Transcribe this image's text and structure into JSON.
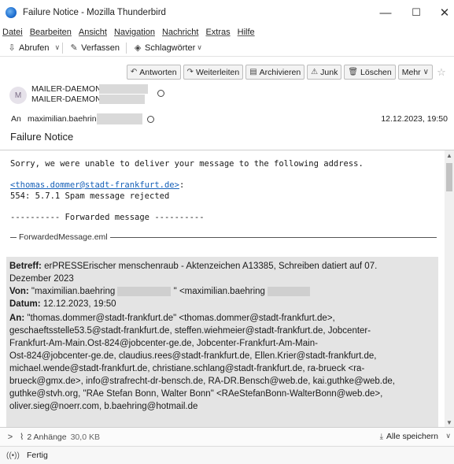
{
  "window": {
    "title": "Failure Notice - Mozilla Thunderbird",
    "minimize_glyph": "—",
    "maximize_glyph": "☐",
    "close_glyph": "✕"
  },
  "menu": [
    "Datei",
    "Bearbeiten",
    "Ansicht",
    "Navigation",
    "Nachricht",
    "Extras",
    "Hilfe"
  ],
  "toolbar": {
    "get_mail": "Abrufen",
    "compose": "Verfassen",
    "tags": "Schlagwörter"
  },
  "actions": {
    "reply": "Antworten",
    "forward": "Weiterleiten",
    "archive": "Archivieren",
    "junk": "Junk",
    "delete": "Löschen",
    "more": "Mehr"
  },
  "message": {
    "avatar_initial": "M",
    "from_name": "MAILER-DAEMON",
    "from_address": "MAILER-DAEMON",
    "to_label": "An",
    "to_value": "maximilian.baehring",
    "date": "12.12.2023, 19:50",
    "subject": "Failure Notice"
  },
  "body": {
    "intro": "Sorry, we were unable to deliver your message to the following address.",
    "failed_address": "<thomas.dommer@stadt-frankfurt.de>",
    "failed_address_suffix": ":",
    "error_line": "554: 5.7.1 Spam message rejected",
    "forwarded_separator": "---------- Forwarded message ----------",
    "attachment_title": "ForwardedMessage.eml"
  },
  "forwarded": {
    "subject_label": "Betreff:",
    "subject_line1": "erPRESSErischer menschenraub - Aktenzeichen A13385, Schreiben datiert auf 07.",
    "subject_line2": "Dezember 2023",
    "from_label": "Von:",
    "from_value": "\"maximilian.baehring",
    "from_value_tail": "\" <maximilian.baehring",
    "date_label": "Datum:",
    "date_value": "12.12.2023, 19:50",
    "to_label": "An:",
    "to_lines": [
      "\"thomas.dommer@stadt-frankfurt.de\" <thomas.dommer@stadt-frankfurt.de>,",
      "geschaeftsstelle53.5@stadt-frankfurt.de, steffen.wiehmeier@stadt-frankfurt.de, Jobcenter-",
      "Frankfurt-Am-Main.Ost-824@jobcenter-ge.de, Jobcenter-Frankfurt-Am-Main-",
      "Ost-824@jobcenter-ge.de, claudius.rees@stadt-frankfurt.de, Ellen.Krier@stadt-frankfurt.de,",
      "michael.wende@stadt-frankfurt.de, christiane.schlang@stadt-frankfurt.de, ra-brueck <ra-",
      "brueck@gmx.de>, info@strafrecht-dr-bensch.de, RA-DR.Bensch@web.de, kai.guthke@web.de,",
      "guthke@stvh.org, \"RAe Stefan Bonn, Walter Bonn\" <RAeStefanBonn-WalterBonn@web.de>,",
      "oliver.sieg@noerr.com, b.baehring@hotmail.de"
    ]
  },
  "attachments": {
    "count_label": "2 Anhänge",
    "size": "30,0 KB",
    "save_all": "Alle speichern"
  },
  "status": {
    "text": "Fertig"
  }
}
